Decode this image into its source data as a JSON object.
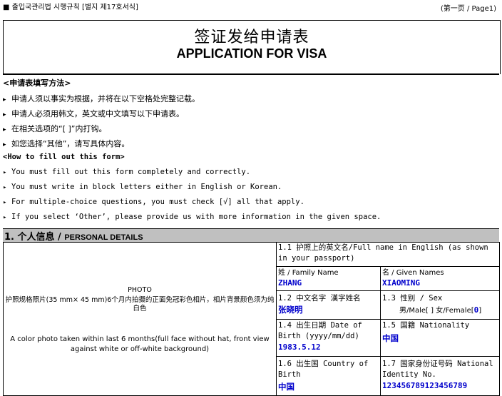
{
  "header": {
    "form_ref": "■ 출입국관리법 시행규칙 [별지 제17호서식]",
    "page_ref": "(第一页 / Page1)"
  },
  "title": {
    "cn": "签证发给申请表",
    "en": "APPLICATION FOR VISA"
  },
  "instructions": {
    "cn_heading": "<申请表填写方法>",
    "cn_items": [
      "申请人须以事实为根据，并将在以下空格处完整记载。",
      "申请人必须用韩文，英文或中文填写以下申请表。",
      "在相关选项的“[ ]”内打钩。",
      "如您选择“其他”，请写具体内容。"
    ],
    "en_heading": "<How to fill out this form>",
    "en_items": [
      "You must fill out this form completely and correctly.",
      "You must write in block letters either in English or Korean.",
      "For multiple-choice questions, you must check [√] all that apply.",
      "If you select ‘Other’, please provide us with more information in the given space."
    ],
    "bullet_glyph": "▸"
  },
  "section1": {
    "title_cn": "1. 个人信息 /",
    "title_en": "PERSONAL DETAILS"
  },
  "photo": {
    "heading": "PHOTO",
    "cn_text": "护照规格照片(35 mm× 45 mm)6个月内拍摄的正面免冠彩色相片，相片背景颜色须为纯白色",
    "en_text": "A color photo taken within last 6 months(full face without hat, front view against white or off-white background)"
  },
  "fields": {
    "full_name_label": "1.1 护照上的英文名/Full name in English (as shown in your passport)",
    "surname_label": "姓 / Family Name",
    "surname_value": "ZHANG",
    "given_label": "名 / Given Names",
    "given_value": "XIAOMING",
    "cn_name_label": "1.2 中文名字 漢字姓名",
    "cn_name_value": "张晓明",
    "sex_label": "1.3 性别 / Sex",
    "sex_options": "男/Male[ ] 女/Female[",
    "sex_checked": "0",
    "sex_close": "]",
    "dob_label": "1.4 出生日期 Date of Birth (yyyy/mm/dd)",
    "dob_value": "1983.5.12",
    "nationality_label": "1.5 国籍 Nationality",
    "nationality_value": "中国",
    "birth_country_label": "1.6 出生国 Country of Birth",
    "birth_country_value": "中国",
    "id_label": "1.7 国家身份证号码 National Identity No.",
    "id_value": "123456789123456789"
  }
}
